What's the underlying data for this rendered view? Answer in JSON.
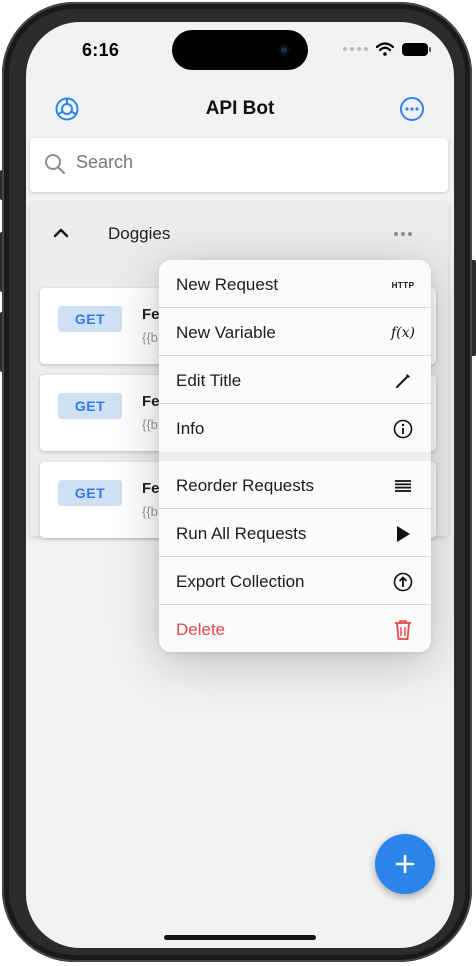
{
  "status": {
    "time": "6:16"
  },
  "nav": {
    "title": "API Bot",
    "left_icon": "gear-icon",
    "right_icon": "ellipsis-circle-icon"
  },
  "search": {
    "placeholder": "Search",
    "icon": "search-icon"
  },
  "collection": {
    "title": "Doggies",
    "requests": [
      {
        "method": "GET",
        "name": "Fe",
        "url": "{{b"
      },
      {
        "method": "GET",
        "name": "Fe",
        "url": "{{b"
      },
      {
        "method": "GET",
        "name": "Fe",
        "url": "{{b"
      }
    ]
  },
  "menu": {
    "items": [
      {
        "label": "New Request",
        "icon": "http-icon",
        "icon_text": "HTTP"
      },
      {
        "label": "New Variable",
        "icon": "function-icon",
        "icon_text": "f(x)"
      },
      {
        "label": "Edit Title",
        "icon": "pencil-icon"
      },
      {
        "label": "Info",
        "icon": "info-icon"
      },
      {
        "label": "Reorder Requests",
        "icon": "list-icon"
      },
      {
        "label": "Run All Requests",
        "icon": "play-icon"
      },
      {
        "label": "Export Collection",
        "icon": "upload-icon"
      },
      {
        "label": "Delete",
        "icon": "trash-icon",
        "destructive": true
      }
    ]
  },
  "fab": {
    "icon": "plus-icon"
  },
  "colors": {
    "accent": "#2b85ea",
    "destructive": "#e8484b",
    "method_badge_bg": "#cfe0f5",
    "method_badge_text": "#2f7de1"
  }
}
